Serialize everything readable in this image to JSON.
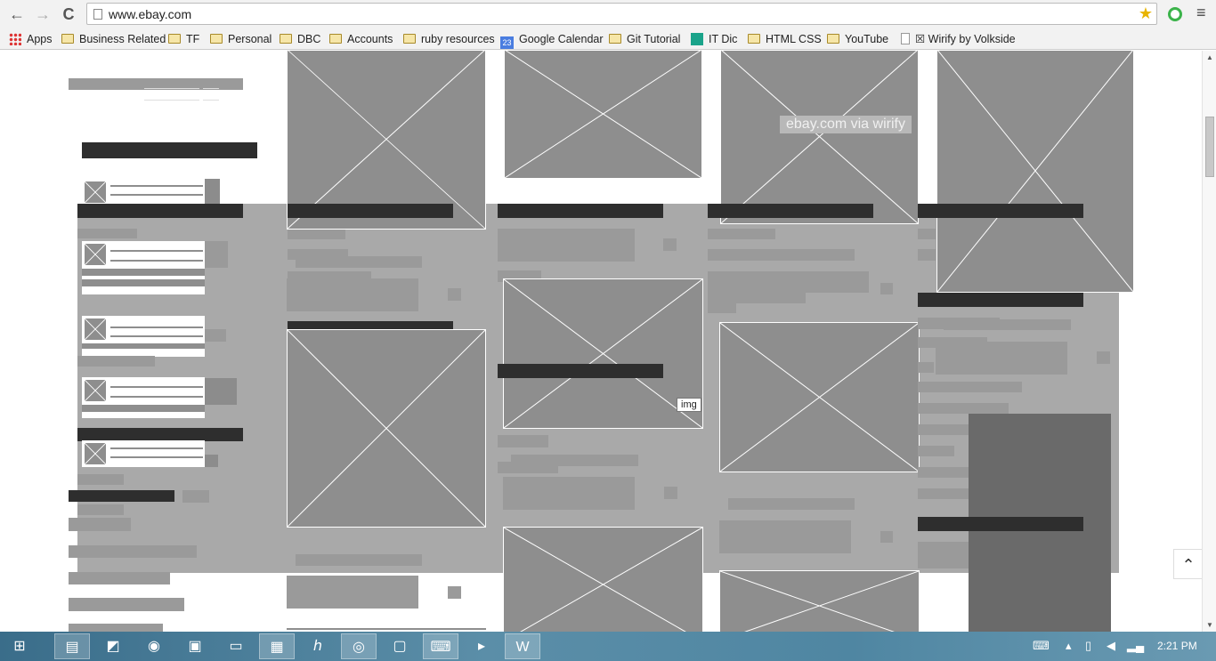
{
  "browser": {
    "url": "www.ebay.com",
    "back_glyph": "←",
    "forward_glyph": "→",
    "reload_glyph": "C",
    "star_glyph": "★",
    "menu_glyph": "≡"
  },
  "bookmarks": {
    "items": [
      {
        "label": "Apps",
        "icon": "apps-icon"
      },
      {
        "label": "Business Related",
        "icon": "folder-icon"
      },
      {
        "label": "TF",
        "icon": "folder-icon"
      },
      {
        "label": "Personal",
        "icon": "folder-icon"
      },
      {
        "label": "DBC",
        "icon": "folder-icon"
      },
      {
        "label": "Accounts",
        "icon": "folder-icon"
      },
      {
        "label": "ruby resources",
        "icon": "folder-icon"
      },
      {
        "label": "Google Calendar",
        "icon": "calendar-icon",
        "badge": "23"
      },
      {
        "label": "Git Tutorial",
        "icon": "folder-icon"
      },
      {
        "label": "IT Dic",
        "icon": "itdic-icon"
      },
      {
        "label": "HTML CSS",
        "icon": "folder-icon"
      },
      {
        "label": "YouTube",
        "icon": "folder-icon"
      },
      {
        "label": "☒ Wirify by Volkside",
        "icon": "page-icon"
      }
    ]
  },
  "page": {
    "watermark": "ebay.com via wirify",
    "img_tooltip": "img",
    "back_to_top_glyph": "⌃"
  },
  "taskbar": {
    "start_glyph": "⊞",
    "clock": "2:21 PM"
  },
  "colors": {
    "wire_bg": "#a9a9a9",
    "wire_dark": "#2e2e2e",
    "placeholder": "#8e8e8e",
    "taskbar": "#4f86a2"
  }
}
